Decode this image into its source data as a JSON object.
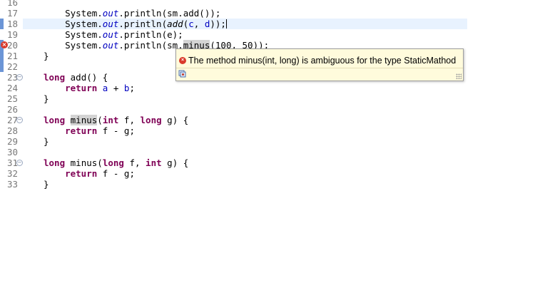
{
  "editor": {
    "lines": [
      {
        "no": "16"
      },
      {
        "no": "17"
      },
      {
        "no": "18"
      },
      {
        "no": "19"
      },
      {
        "no": "20"
      },
      {
        "no": "21"
      },
      {
        "no": "22"
      },
      {
        "no": "23"
      },
      {
        "no": "24"
      },
      {
        "no": "25"
      },
      {
        "no": "26"
      },
      {
        "no": "27"
      },
      {
        "no": "28"
      },
      {
        "no": "29"
      },
      {
        "no": "30"
      },
      {
        "no": "31"
      },
      {
        "no": "32"
      },
      {
        "no": "33"
      }
    ],
    "tokens": {
      "system": "System",
      "out": "out",
      "println": "println",
      "sm": "sm",
      "add": "add",
      "c": "c",
      "d": "d",
      "e": "e",
      "minus": "minus",
      "n100": "100",
      "n50": "50",
      "long": "long",
      "int": "int",
      "return": "return",
      "a": "a",
      "b": "b",
      "f": "f",
      "g": "g"
    }
  },
  "hover": {
    "message": "The method minus(int, long) is ambiguous for the type StaticMathod",
    "quickfix_icon": "quick-fix-icon"
  },
  "colors": {
    "keyword": "#7f0055",
    "field": "#0000c0",
    "current_line": "#e8f2fe",
    "popup_bg": "#fffbdc",
    "error": "#d93a2b"
  }
}
